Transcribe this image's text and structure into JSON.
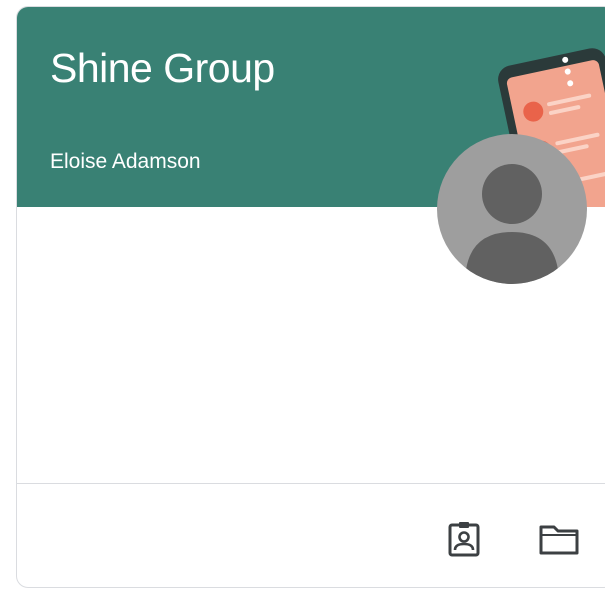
{
  "card": {
    "class_name": "Shine Group",
    "teacher_name": "Eloise Adamson",
    "header_color": "#398174"
  },
  "footer": {
    "actions": [
      {
        "icon": "assignment-ind-icon"
      },
      {
        "icon": "folder-icon"
      }
    ]
  },
  "colors": {
    "accent": "#398174",
    "avatar_bg": "#9e9e9e",
    "avatar_figure": "#616161"
  }
}
